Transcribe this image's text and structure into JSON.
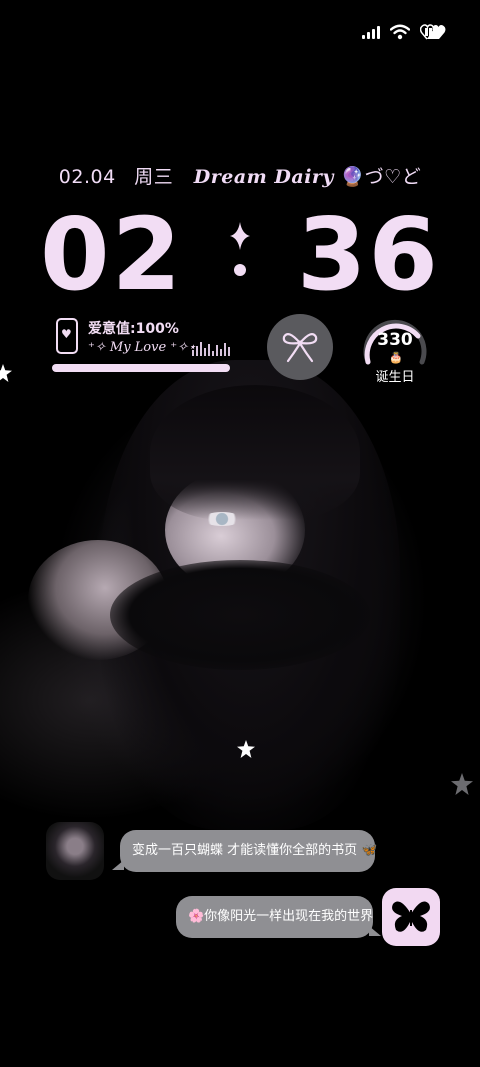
{
  "status_bar": {
    "signal_icon": "signal-bars-icon",
    "wifi_icon": "wifi-icon",
    "battery_icon": "heart-battery-icon"
  },
  "date_line": {
    "date": "02.04",
    "weekday": "周三",
    "title": "Dream Dairy",
    "title_decoration": "🔮づ♡ど"
  },
  "clock": {
    "hours": "02",
    "minutes": "36"
  },
  "love_widget": {
    "label": "爱意值:100%",
    "subtitle": "⁺✧ My Love ⁺✧⋆",
    "level": 1.0
  },
  "bow_widget": {
    "icon": "ribbon-bow-icon"
  },
  "birthday_widget": {
    "days": "330",
    "label": "诞生日",
    "icon": "birthday-cake-icon",
    "progress": 0.8
  },
  "chat": {
    "messages": [
      {
        "text": "变成一百只蝴蝶 才能读懂你全部的书页 🦋",
        "side": "left"
      },
      {
        "text": "🌸你像阳光一样出现在我的世界",
        "side": "right"
      }
    ]
  },
  "colors": {
    "accent": "#f2ddf4",
    "bubble": "#8f8f93",
    "tile": "#f2d9f2"
  }
}
